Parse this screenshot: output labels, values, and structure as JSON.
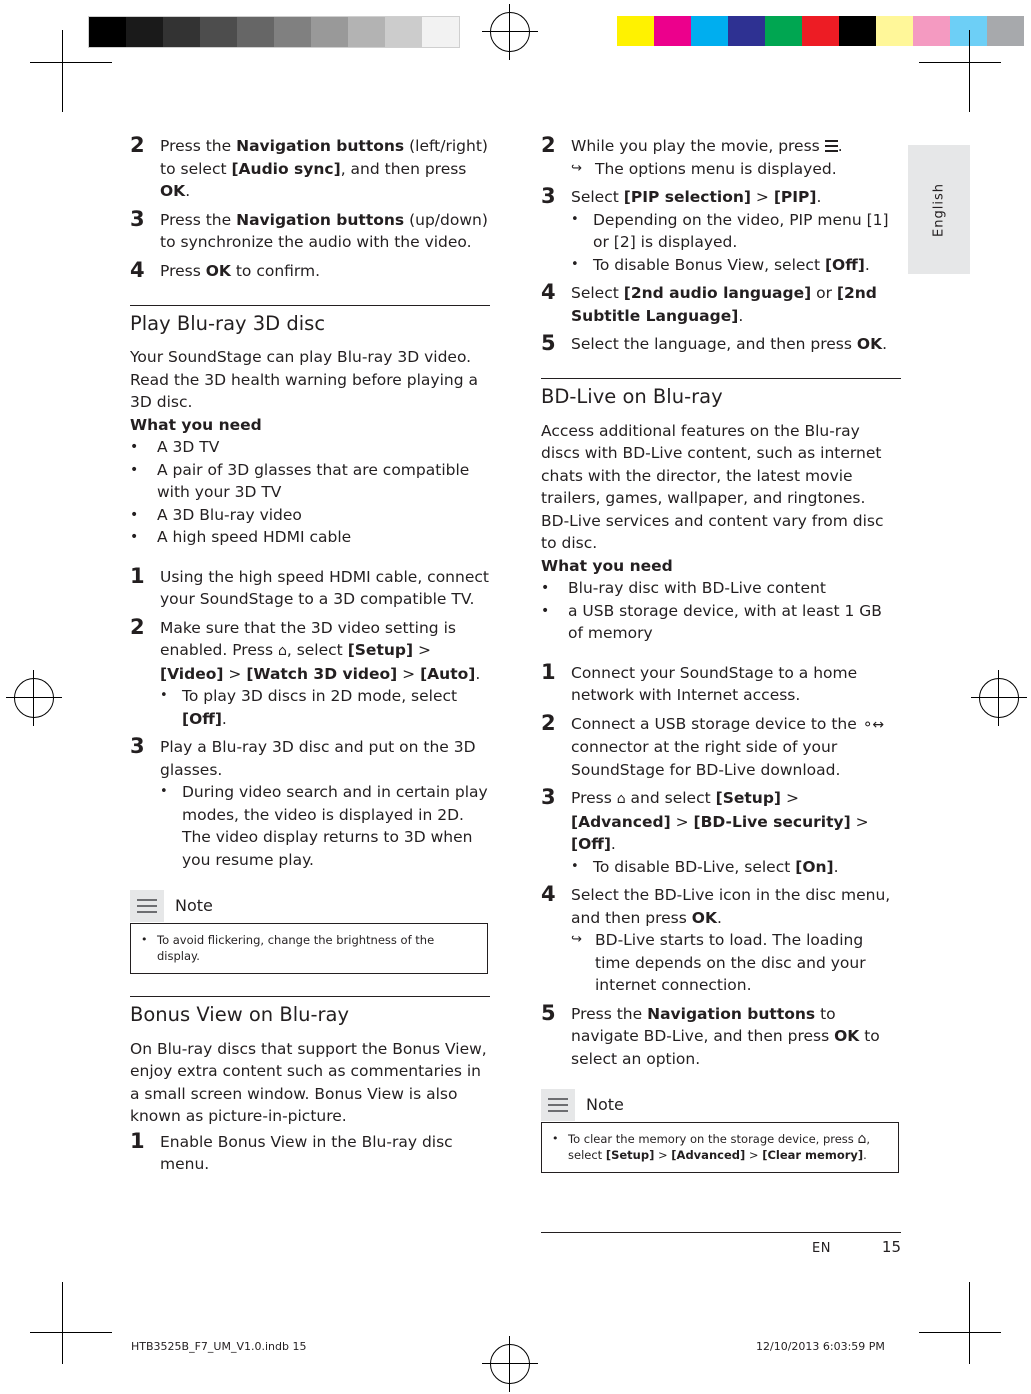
{
  "document": {
    "language_tab": "English",
    "footer": {
      "lang_code": "EN",
      "page_number": "15"
    },
    "imprint_left": "HTB3525B_F7_UM_V1.0.indb   15",
    "imprint_right": "12/10/2013   6:03:59 PM"
  },
  "left_column": {
    "steps_top": [
      {
        "num": "2",
        "parts": [
          {
            "t": "Press the ",
            "b": false
          },
          {
            "t": "Navigation buttons",
            "b": true
          },
          {
            "t": " (left/right) to select ",
            "b": false
          },
          {
            "t": "[Audio sync]",
            "b": true
          },
          {
            "t": ", and then press ",
            "b": false
          },
          {
            "t": "OK",
            "b": true
          },
          {
            "t": ".",
            "b": false
          }
        ]
      },
      {
        "num": "3",
        "parts": [
          {
            "t": "Press the ",
            "b": false
          },
          {
            "t": "Navigation buttons",
            "b": true
          },
          {
            "t": " (up/down) to synchronize the audio with the video.",
            "b": false
          }
        ]
      },
      {
        "num": "4",
        "parts": [
          {
            "t": "Press ",
            "b": false
          },
          {
            "t": "OK",
            "b": true
          },
          {
            "t": " to confirm.",
            "b": false
          }
        ]
      }
    ],
    "section1": {
      "heading": "Play Blu-ray 3D disc",
      "intro": "Your SoundStage can play Blu-ray 3D video. Read the 3D health warning before playing a 3D disc.",
      "what_you_need_label": "What you need",
      "requirements": [
        "A 3D TV",
        "A pair of 3D glasses that are compatible with your 3D TV",
        "A 3D Blu-ray video",
        "A high speed HDMI cable"
      ],
      "steps": [
        {
          "num": "1",
          "parts": [
            {
              "t": "Using the high speed HDMI cable, connect your SoundStage to a 3D compatible TV.",
              "b": false
            }
          ]
        },
        {
          "num": "2",
          "parts": [
            {
              "t": "Make sure that the 3D video setting is enabled. Press ",
              "b": false
            },
            {
              "t": "HOME_ICON",
              "b": false,
              "icon": "home"
            },
            {
              "t": ", select ",
              "b": false
            },
            {
              "t": "[Setup]",
              "b": true
            },
            {
              "t": " > ",
              "b": false
            },
            {
              "t": "[Video]",
              "b": true
            },
            {
              "t": " > ",
              "b": false
            },
            {
              "t": "[Watch 3D video]",
              "b": true
            },
            {
              "t": " > ",
              "b": false
            },
            {
              "t": "[Auto]",
              "b": true
            },
            {
              "t": ".",
              "b": false
            }
          ],
          "sub": [
            {
              "parts": [
                {
                  "t": "To play 3D discs in 2D mode, select ",
                  "b": false
                },
                {
                  "t": "[Off]",
                  "b": true
                },
                {
                  "t": ".",
                  "b": false
                }
              ]
            }
          ]
        },
        {
          "num": "3",
          "parts": [
            {
              "t": "Play a Blu-ray 3D disc and put on the 3D glasses.",
              "b": false
            }
          ],
          "sub": [
            {
              "parts": [
                {
                  "t": "During video search and in certain play modes, the video is displayed in 2D. The video display returns to 3D when you resume play.",
                  "b": false
                }
              ]
            }
          ]
        }
      ],
      "note": {
        "title": "Note",
        "text": "To avoid flickering, change the brightness of the display."
      }
    },
    "section2": {
      "heading": "Bonus View on Blu-ray",
      "intro": "On Blu-ray discs that support the Bonus View, enjoy extra content such as commentaries in a small screen window. Bonus View is also known as picture-in-picture.",
      "steps": [
        {
          "num": "1",
          "parts": [
            {
              "t": "Enable Bonus View in the Blu-ray disc menu.",
              "b": false
            }
          ]
        }
      ]
    }
  },
  "right_column": {
    "steps_top": [
      {
        "num": "2",
        "parts": [
          {
            "t": "While you play the movie, press ",
            "b": false
          },
          {
            "t": "LIST_ICON",
            "b": false,
            "icon": "list"
          },
          {
            "t": ".",
            "b": false
          }
        ],
        "arrow": [
          {
            "parts": [
              {
                "t": "The options menu is displayed.",
                "b": false
              }
            ]
          }
        ]
      },
      {
        "num": "3",
        "parts": [
          {
            "t": "Select ",
            "b": false
          },
          {
            "t": "[PIP selection]",
            "b": true
          },
          {
            "t": " > ",
            "b": false
          },
          {
            "t": "[PIP]",
            "b": true
          },
          {
            "t": ".",
            "b": false
          }
        ],
        "sub": [
          {
            "parts": [
              {
                "t": "Depending on the video, PIP menu [1] or [2] is displayed.",
                "b": false
              }
            ]
          },
          {
            "parts": [
              {
                "t": "To disable Bonus View, select ",
                "b": false
              },
              {
                "t": "[Off]",
                "b": true
              },
              {
                "t": ".",
                "b": false
              }
            ]
          }
        ]
      },
      {
        "num": "4",
        "parts": [
          {
            "t": "Select ",
            "b": false
          },
          {
            "t": "[2nd audio language]",
            "b": true
          },
          {
            "t": " or ",
            "b": false
          },
          {
            "t": "[2nd Subtitle Language]",
            "b": true
          },
          {
            "t": ".",
            "b": false
          }
        ]
      },
      {
        "num": "5",
        "parts": [
          {
            "t": "Select the language, and then press ",
            "b": false
          },
          {
            "t": "OK",
            "b": true
          },
          {
            "t": ".",
            "b": false
          }
        ]
      }
    ],
    "section1": {
      "heading": "BD-Live on Blu-ray",
      "intro1": "Access additional features on the Blu-ray discs with BD-Live content, such as internet chats with the director, the latest movie trailers, games, wallpaper, and ringtones.",
      "intro2": "BD-Live services and content vary from disc to disc.",
      "what_you_need_label": "What you need",
      "requirements": [
        "Blu-ray disc with BD-Live content",
        "a USB storage device, with at least 1 GB of memory"
      ],
      "steps": [
        {
          "num": "1",
          "parts": [
            {
              "t": "Connect your SoundStage to a home network with Internet access.",
              "b": false
            }
          ]
        },
        {
          "num": "2",
          "parts": [
            {
              "t": "Connect a USB storage device to the ",
              "b": false
            },
            {
              "t": "USB_ICON",
              "b": false,
              "icon": "usb"
            },
            {
              "t": " connector at the right side of your SoundStage for BD-Live download.",
              "b": false
            }
          ]
        },
        {
          "num": "3",
          "parts": [
            {
              "t": "Press ",
              "b": false
            },
            {
              "t": "HOME_ICON",
              "b": false,
              "icon": "home"
            },
            {
              "t": " and select ",
              "b": false
            },
            {
              "t": "[Setup]",
              "b": true
            },
            {
              "t": " > ",
              "b": false
            },
            {
              "t": "[Advanced]",
              "b": true
            },
            {
              "t": " > ",
              "b": false
            },
            {
              "t": "[BD-Live security]",
              "b": true
            },
            {
              "t": " > ",
              "b": false
            },
            {
              "t": "[Off]",
              "b": true
            },
            {
              "t": ".",
              "b": false
            }
          ],
          "sub": [
            {
              "parts": [
                {
                  "t": "To disable BD-Live, select ",
                  "b": false
                },
                {
                  "t": "[On]",
                  "b": true
                },
                {
                  "t": ".",
                  "b": false
                }
              ]
            }
          ]
        },
        {
          "num": "4",
          "parts": [
            {
              "t": "Select the BD-Live icon in the disc menu, and then press ",
              "b": false
            },
            {
              "t": "OK",
              "b": true
            },
            {
              "t": ".",
              "b": false
            }
          ],
          "arrow": [
            {
              "parts": [
                {
                  "t": "BD-Live starts to load. The loading time depends on the disc and your internet connection.",
                  "b": false
                }
              ]
            }
          ]
        },
        {
          "num": "5",
          "parts": [
            {
              "t": "Press the ",
              "b": false
            },
            {
              "t": "Navigation buttons",
              "b": true
            },
            {
              "t": " to navigate BD-Live, and then press ",
              "b": false
            },
            {
              "t": "OK",
              "b": true
            },
            {
              "t": " to select an option.",
              "b": false
            }
          ]
        }
      ],
      "note": {
        "title": "Note",
        "parts": [
          {
            "t": "To clear the memory on the storage device, press ",
            "b": false
          },
          {
            "t": "HOME_ICON",
            "b": false,
            "icon": "home"
          },
          {
            "t": ", select ",
            "b": false
          },
          {
            "t": "[Setup]",
            "b": true
          },
          {
            "t": " > ",
            "b": false
          },
          {
            "t": "[Advanced]",
            "b": true
          },
          {
            "t": " > ",
            "b": false
          },
          {
            "t": "[Clear memory]",
            "b": true
          },
          {
            "t": ".",
            "b": false
          }
        ]
      }
    }
  },
  "print_marks": {
    "grayscale_bar": [
      "#000000",
      "#1a1a1a",
      "#333333",
      "#4d4d4d",
      "#666666",
      "#808080",
      "#999999",
      "#b3b3b3",
      "#cccccc",
      "#f2f2f2"
    ],
    "color_bar": [
      "#fff200",
      "#ec008c",
      "#00aeef",
      "#2e3192",
      "#00a651",
      "#ed1c24",
      "#000000",
      "#fff799",
      "#f49ac1",
      "#6dcff6",
      "#a7a9ac"
    ]
  }
}
